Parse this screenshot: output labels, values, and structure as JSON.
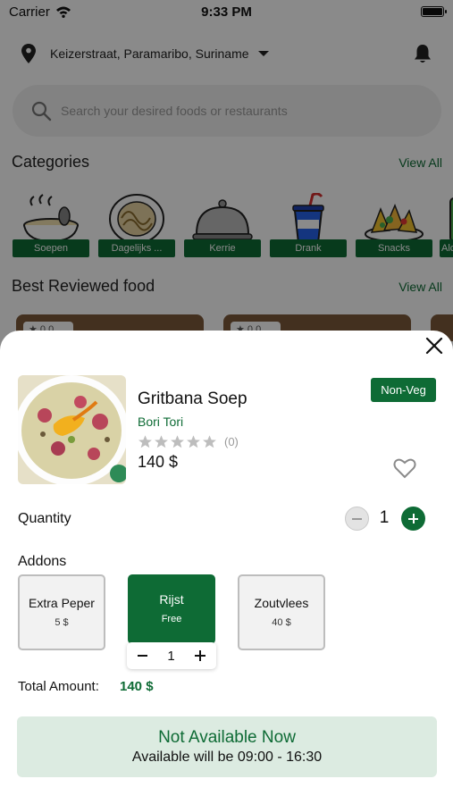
{
  "status_bar": {
    "carrier": "Carrier",
    "time": "9:33 PM"
  },
  "header": {
    "location": "Keizerstraat, Paramaribo, Suriname"
  },
  "search": {
    "placeholder": "Search your desired foods or restaurants"
  },
  "categories": {
    "title": "Categories",
    "view_all": "View All",
    "items": [
      {
        "label": "Soepen"
      },
      {
        "label": "Dagelijks ..."
      },
      {
        "label": "Kerrie"
      },
      {
        "label": "Drank"
      },
      {
        "label": "Snacks"
      },
      {
        "label": "Alc"
      }
    ]
  },
  "best_reviewed": {
    "title": "Best Reviewed food",
    "view_all": "View All",
    "card_rating": "0.0"
  },
  "product": {
    "name": "Gritbana Soep",
    "restaurant": "Bori Tori",
    "rating_count": "(0)",
    "rating": 0,
    "price": "140 $",
    "badge": "Non-Veg",
    "quantity_label": "Quantity",
    "quantity": "1"
  },
  "addons": {
    "label": "Addons",
    "items": [
      {
        "name": "Extra Peper",
        "price": "5 $",
        "selected": false
      },
      {
        "name": "Rijst",
        "price": "Free",
        "selected": true,
        "quantity": "1"
      },
      {
        "name": "Zoutvlees",
        "price": "40 $",
        "selected": false
      }
    ]
  },
  "total": {
    "label": "Total Amount:",
    "value": "140 $"
  },
  "availability": {
    "title": "Not Available Now",
    "subtitle": "Available will be 09:00 - 16:30"
  },
  "colors": {
    "primary": "#0e6b35",
    "availability_bg": "#dcebe1",
    "star_empty": "#bdbdbd"
  }
}
